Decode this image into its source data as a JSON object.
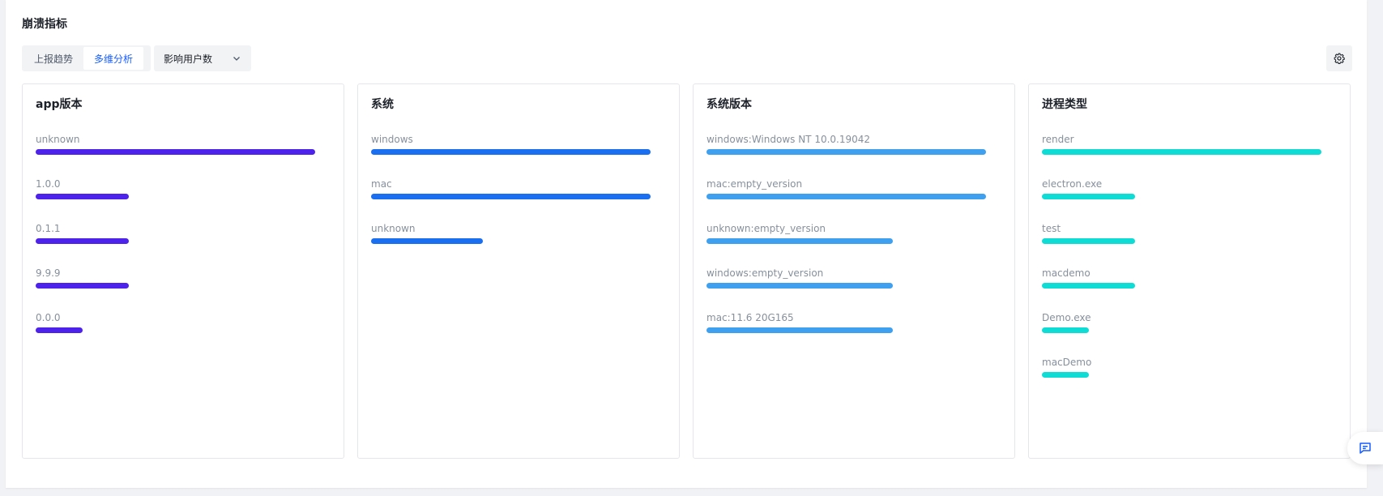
{
  "title": "崩溃指标",
  "tabs": [
    {
      "label": "上报趋势",
      "active": false
    },
    {
      "label": "多维分析",
      "active": true
    }
  ],
  "metric_select": {
    "value": "影响用户数"
  },
  "icons": {
    "settings": "gear-icon",
    "dropdown": "chevron-down-icon",
    "feedback": "message-icon"
  },
  "cards": [
    {
      "title": "app版本",
      "color": "#4d22ea",
      "items": [
        {
          "label": "unknown",
          "fraction": 1.0
        },
        {
          "label": "1.0.0",
          "fraction": 0.333
        },
        {
          "label": "0.1.1",
          "fraction": 0.333
        },
        {
          "label": "9.9.9",
          "fraction": 0.333
        },
        {
          "label": "0.0.0",
          "fraction": 0.167
        }
      ]
    },
    {
      "title": "系统",
      "color": "#1a6ff0",
      "items": [
        {
          "label": "windows",
          "fraction": 1.0
        },
        {
          "label": "mac",
          "fraction": 1.0
        },
        {
          "label": "unknown",
          "fraction": 0.4
        }
      ]
    },
    {
      "title": "系统版本",
      "color": "#3ea0ee",
      "items": [
        {
          "label": "windows:Windows NT 10.0.19042",
          "fraction": 1.0
        },
        {
          "label": "mac:empty_version",
          "fraction": 1.0
        },
        {
          "label": "unknown:empty_version",
          "fraction": 0.667
        },
        {
          "label": "windows:empty_version",
          "fraction": 0.667
        },
        {
          "label": "mac:11.6 20G165",
          "fraction": 0.667
        }
      ]
    },
    {
      "title": "进程类型",
      "color": "#10dcd6",
      "items": [
        {
          "label": "render",
          "fraction": 1.0
        },
        {
          "label": "electron.exe",
          "fraction": 0.333
        },
        {
          "label": "test",
          "fraction": 0.333
        },
        {
          "label": "macdemo",
          "fraction": 0.333
        },
        {
          "label": "Demo.exe",
          "fraction": 0.167
        },
        {
          "label": "macDemo",
          "fraction": 0.167
        }
      ]
    }
  ]
}
